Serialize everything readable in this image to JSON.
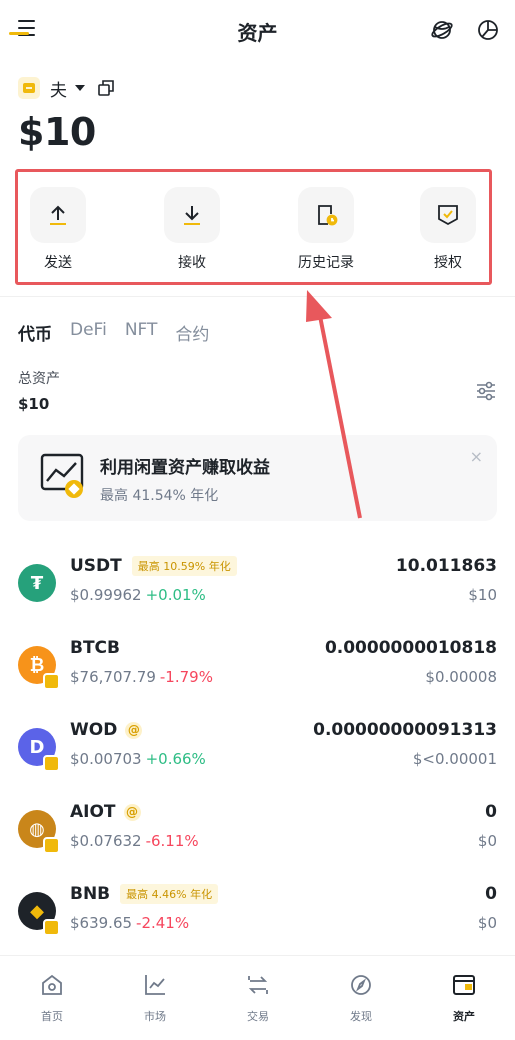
{
  "header": {
    "title": "资产",
    "menu_icon": "menu-icon",
    "globe_icon": "globe-icon",
    "pie_icon": "pie-chart-icon"
  },
  "wallet": {
    "name": "夫",
    "balance": "$10"
  },
  "actions": [
    {
      "label": "发送",
      "icon": "send-icon"
    },
    {
      "label": "接收",
      "icon": "receive-icon"
    },
    {
      "label": "历史记录",
      "icon": "history-icon"
    },
    {
      "label": "授权",
      "icon": "authorize-icon"
    }
  ],
  "tabs": [
    {
      "label": "代币",
      "active": true
    },
    {
      "label": "DeFi",
      "active": false
    },
    {
      "label": "NFT",
      "active": false
    },
    {
      "label": "合约",
      "active": false
    }
  ],
  "summary": {
    "total_label": "总资产",
    "total_value": "$10"
  },
  "promo": {
    "title": "利用闲置资产赚取收益",
    "subtitle": "最高 41.54% 年化",
    "close": "×"
  },
  "assets": [
    {
      "symbol": "USDT",
      "tag": "最高 10.59% 年化",
      "price": "$0.99962",
      "change": "+0.01%",
      "amount": "10.011863",
      "value": "$10",
      "color": "#26a17b",
      "glyph": "₮"
    },
    {
      "symbol": "BTCB",
      "tag": "",
      "price": "$76,707.79",
      "change": "-1.79%",
      "amount": "0.0000000010818",
      "value": "$0.00008",
      "color": "#f7931a",
      "glyph": "₿"
    },
    {
      "symbol": "WOD",
      "tag": "",
      "price": "$0.00703",
      "change": "+0.66%",
      "amount": "0.00000000091313",
      "value": "$<0.00001",
      "color": "#5b63e8",
      "glyph": "D"
    },
    {
      "symbol": "AIOT",
      "tag": "",
      "price": "$0.07632",
      "change": "-6.11%",
      "amount": "0",
      "value": "$0",
      "color": "#c9861a",
      "glyph": "◍"
    },
    {
      "symbol": "BNB",
      "tag": "最高 4.46% 年化",
      "price": "$639.65",
      "change": "-2.41%",
      "amount": "0",
      "value": "$0",
      "color": "#1e2329",
      "glyph": "◆"
    }
  ],
  "nav": [
    {
      "label": "首页",
      "icon": "home-icon",
      "active": false
    },
    {
      "label": "市场",
      "icon": "market-chart-icon",
      "active": false
    },
    {
      "label": "交易",
      "icon": "trade-icon",
      "active": false
    },
    {
      "label": "发现",
      "icon": "discover-icon",
      "active": false
    },
    {
      "label": "资产",
      "icon": "assets-wallet-icon",
      "active": true
    }
  ],
  "colors": {
    "accent": "#f0b90b",
    "up": "#2ebd85",
    "down": "#f6465d",
    "highlight": "#e8585c"
  }
}
